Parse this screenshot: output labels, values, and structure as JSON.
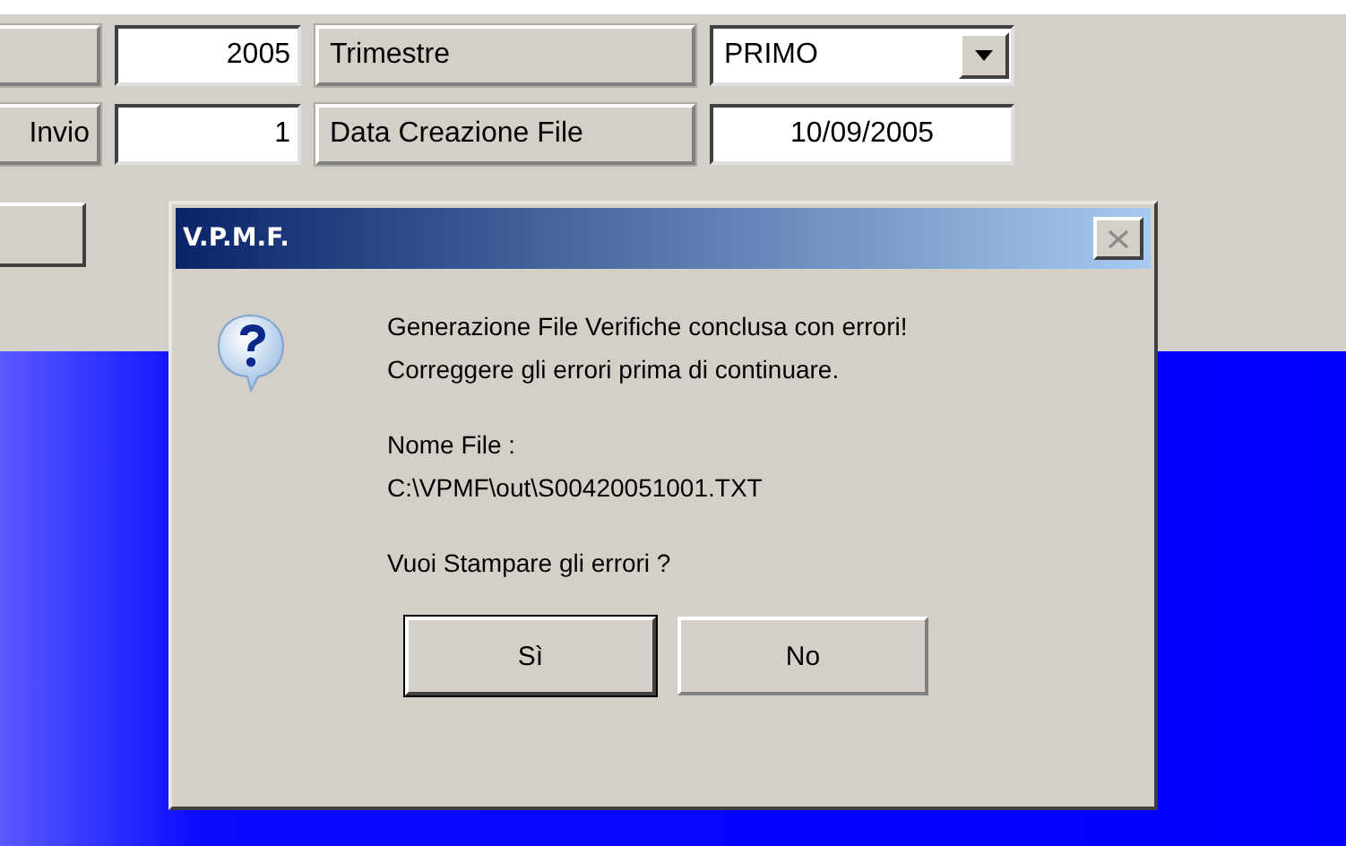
{
  "form": {
    "year_value": "2005",
    "quarter": {
      "label": "Trimestre",
      "value": "PRIMO"
    },
    "send_label": "Invio",
    "send_value": "1",
    "date": {
      "label": "Data Creazione File",
      "value": "10/09/2005"
    }
  },
  "dialog": {
    "title": "V.P.M.F.",
    "paragraphs": [
      "Generazione File Verifiche conclusa con errori!\nCorreggere gli errori prima di continuare.",
      "Nome File :\nC:\\VPMF\\out\\S00420051001.TXT",
      "Vuoi Stampare gli errori ?"
    ],
    "buttons": [
      {
        "label": "Sì",
        "default": true
      },
      {
        "label": "No",
        "default": false
      }
    ]
  }
}
